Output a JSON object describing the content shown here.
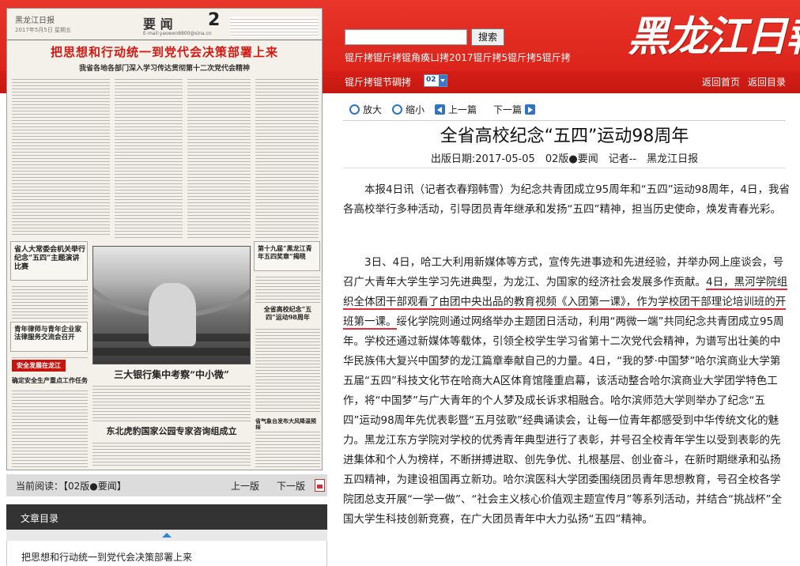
{
  "newspaper": {
    "logo": "黑龙江日报",
    "date": "2017年5月5日 星期五",
    "section": "要 闻",
    "email": "E-mail:yaowen8800@sina.cn",
    "page_number": "2",
    "headline": "把思想和行动统一到党代会决策部署上来",
    "subheadline": "我省各地各部门深入学习传达贯彻第十二次党代会精神",
    "box_left_top": "省人大常委会机关举行纪念“五四”主题演讲比赛",
    "box_left_mid": "青年律师与青年企业家法律服务交流会召开",
    "badge": "安全发展在龙江",
    "box_left_bottom": "确定安全生产重点工作任务",
    "box_right_top": "第十九届“黑龙江青年五四奖章”揭晓",
    "box_right_mid": "全省高校纪念“五四”运动98周年",
    "story_title": "三大银行集中考察“中小微”",
    "story_title2": "东北虎豹国家公园专家咨询组成立",
    "box_right_bottom": "省气象台发布大风降温预报"
  },
  "reading_bar": {
    "current_label": "当前阅读：【02版●要闻】",
    "prev": "上一版",
    "next": "下一版"
  },
  "toc": {
    "heading": "文章目录",
    "items": [
      "把思想和行动统一到党代会决策部署上来"
    ]
  },
  "header": {
    "search_button": "搜索",
    "garbled_line1": "锟斤拷锟斤拷锟角痪ㄩ拷2017锟斤拷5锟斤拷5锟斤拷",
    "garbled_line2": "锟斤拷锟节碉拷",
    "select_value": "02",
    "home": "返回首页",
    "toc_link": "返回目录",
    "masthead": "黑龙江日報"
  },
  "toolbar": {
    "zoom_in": "放大",
    "zoom_out": "缩小",
    "prev_article": "上一篇",
    "next_article": "下一篇"
  },
  "article": {
    "title": "全省高校纪念“五四”运动98周年",
    "meta": "出版日期:2017-05-05　02版●要闻　记者--　黑龙江日报",
    "p1": "本报4日讯（记者衣春翔韩雪）为纪念共青团成立95周年和“五四”运动98周年，4日，我省各高校举行多种活动，引导团员青年继承和发扬“五四”精神，担当历史使命，焕发青春光彩。",
    "p2_before": "3日、4日，哈工大利用新媒体等方式，宣传先进事迹和先进经验，并举办网上座谈会，号召广大青年大学生学习先进典型，为龙江、为国家的经济社会发展多作贡献。",
    "p2_highlight": "4日，黑河学院组织全体团干部观看了由团中央出品的教育视频《入团第一课》，作为学校团干部理论培训班的开班第一课。",
    "p2_after": "绥化学院则通过网络举办主题团日活动，利用“两微一端”共同纪念共青团成立95周年。学校还通过新媒体等载体，引领全校学生学习省第十二次党代会精神，为谱写出壮美的中华民族伟大复兴中国梦的龙江篇章奉献自己的力量。4日，“我的梦·中国梦”哈尔滨商业大学第五届“五四”科技文化节在哈商大A区体育馆隆重启幕，该活动整合哈尔滨商业大学团学特色工作，将“中国梦”与广大青年的个人梦及成长诉求相融合。哈尔滨师范大学则举办了纪念“五四”运动98周年先优表彰暨“五月弦歌”经典诵读会，让每一位青年都感受到中华传统文化的魅力。黑龙江东方学院对学校的优秀青年典型进行了表彰，并号召全校青年学生以受到表彰的先进集体和个人为榜样，不断拼搏进取、创先争优、扎根基层、创业奋斗，在新时期继承和弘扬五四精神，为建设祖国再立新功。哈尔滨医科大学团委围绕团员青年思想教育，号召全校各学院团总支开展“一学一做”、“社会主义核心价值观主题宣传月”等系列活动，并结合“挑战杯”全国大学生科技创新竞赛，在广大团员青年中大力弘扬“五四”精神。"
  }
}
